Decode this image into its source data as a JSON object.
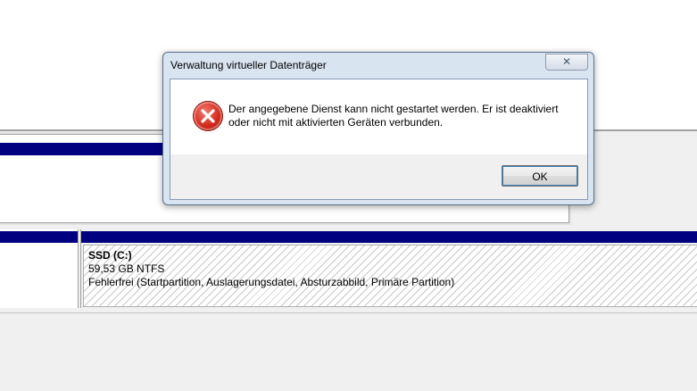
{
  "dialog": {
    "title": "Verwaltung virtueller Datenträger",
    "close_label": "✕",
    "icon": "error-icon",
    "message_line1": "Der angegebene Dienst kann nicht gestartet werden. Er ist deaktiviert",
    "message_line2": "oder nicht mit aktivierten Geräten verbunden.",
    "ok_label": "OK"
  },
  "disk": {
    "partition": {
      "name": "SSD  (C:)",
      "size": "59,53 GB NTFS",
      "status": "Fehlerfrei (Startpartition, Auslagerungsdatei, Absturzabbild, Primäre Partition)"
    }
  },
  "colors": {
    "volume_bar": "#000080",
    "error_red": "#d52a1e"
  }
}
